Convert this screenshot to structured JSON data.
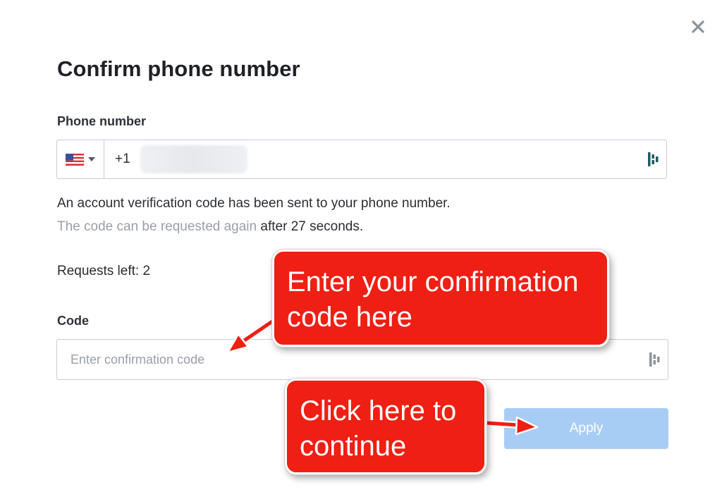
{
  "modal": {
    "title": "Confirm phone number",
    "close_icon": "close-icon"
  },
  "phone": {
    "label": "Phone number",
    "country_flag_icon": "us-flag-icon",
    "dial_code": "+1",
    "value_redacted": true
  },
  "info": {
    "sent_message": "An account verification code has been sent to your phone number.",
    "resend_prefix": "The code can be requested again",
    "resend_timer": "after 27 seconds."
  },
  "requests_left": "Requests left: 2",
  "code": {
    "label": "Code",
    "placeholder": "Enter confirmation code",
    "value": ""
  },
  "apply_button": {
    "label": "Apply"
  },
  "annotations": {
    "callout_code": "Enter your confirmation code here",
    "callout_code_line1": "Enter your confirmation",
    "callout_code_line2": "code here",
    "callout_apply_line1": "Click here to",
    "callout_apply_line2": "continue"
  },
  "colors": {
    "apply_button": "#a8cdf5",
    "callout": "#ef1f13",
    "field_border": "#c8ccd6",
    "muted_text": "#9a9ea8",
    "field_icon": "#1f5c66"
  }
}
